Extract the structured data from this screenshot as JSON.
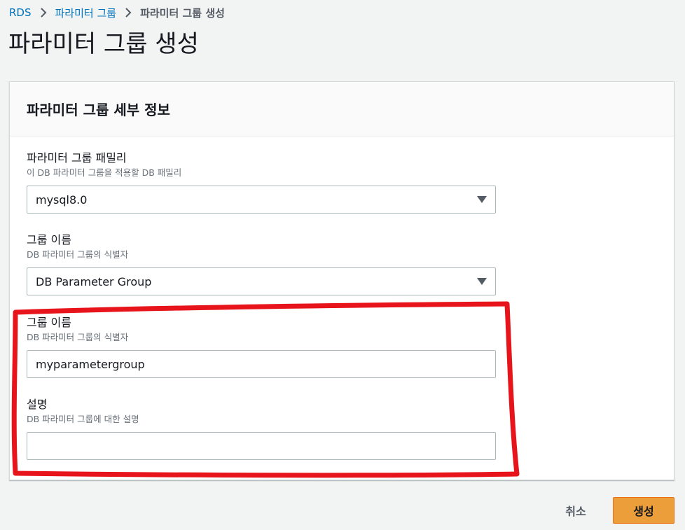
{
  "breadcrumb": {
    "items": [
      "RDS",
      "파라미터 그룹"
    ],
    "current": "파라미터 그룹 생성"
  },
  "page_title": "파라미터 그룹 생성",
  "panel": {
    "title": "파라미터 그룹 세부 정보",
    "fields": [
      {
        "label": "파라미터 그룹 패밀리",
        "description": "이 DB 파라미터 그룹을 적용할 DB 패밀리",
        "value": "mysql8.0",
        "type": "select"
      },
      {
        "label": "그룹 이름",
        "description": "DB 파라미터 그룹의 식별자",
        "value": "DB Parameter Group",
        "type": "select"
      },
      {
        "label": "그룹 이름",
        "description": "DB 파라미터 그룹의 식별자",
        "value": "myparametergroup",
        "type": "input"
      },
      {
        "label": "설명",
        "description": "DB 파라미터 그룹에 대한 설명",
        "value": "",
        "type": "input"
      }
    ]
  },
  "footer": {
    "cancel_label": "취소",
    "create_label": "생성"
  },
  "colors": {
    "link": "#0073bb",
    "primary_button": "#ec9e3b",
    "annotation": "#e8141c"
  },
  "annotation": {
    "shape": "red hand-drawn outline",
    "highlights": [
      "그룹 이름",
      "설명"
    ]
  }
}
